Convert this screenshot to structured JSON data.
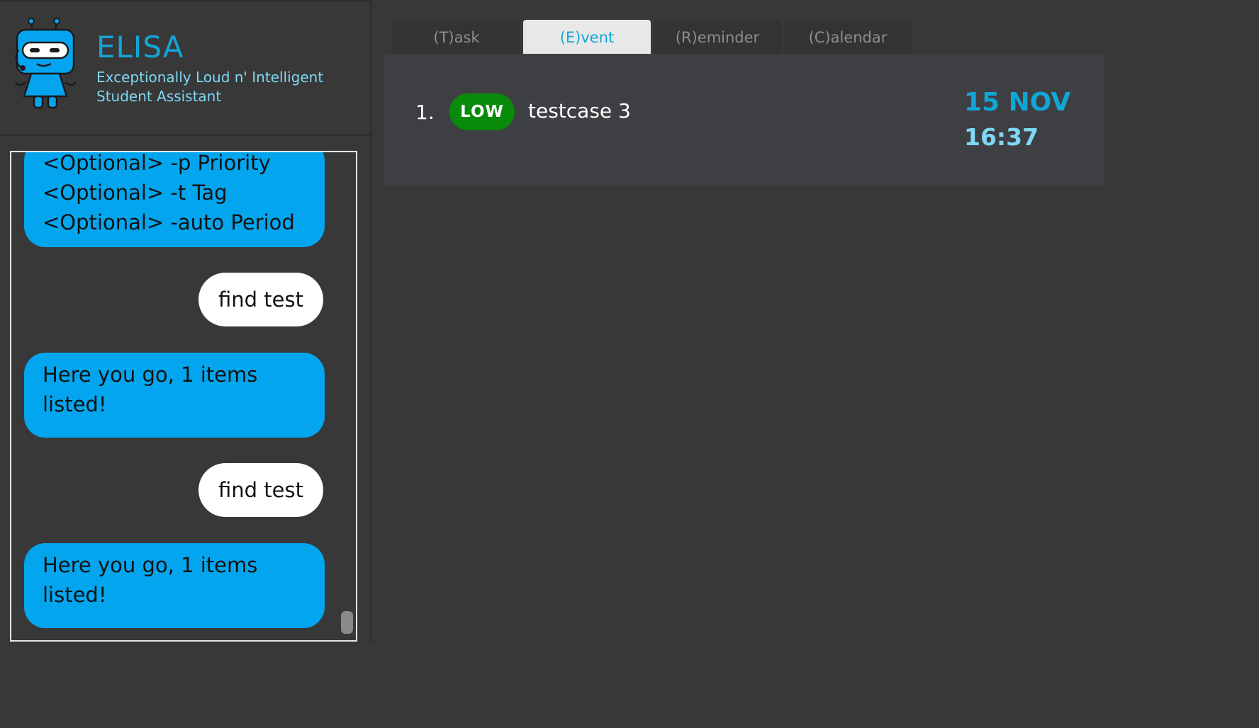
{
  "app": {
    "title": "ELISA",
    "subtitle": "Exceptionally Loud n' Intelligent Student Assistant",
    "logo_icon": "robot-icon"
  },
  "chat": {
    "messages": [
      {
        "sender": "bot",
        "text": "<Optional> -p Priority\n<Optional> -t Tag\n<Optional> -auto Period"
      },
      {
        "sender": "user",
        "text": "find test"
      },
      {
        "sender": "bot",
        "text": "Here you go, 1 items\nlisted!"
      },
      {
        "sender": "user",
        "text": "find test"
      },
      {
        "sender": "bot",
        "text": "Here you go, 1 items\nlisted!"
      }
    ]
  },
  "tabs": [
    {
      "label": "(T)ask",
      "active": false
    },
    {
      "label": "(E)vent",
      "active": true
    },
    {
      "label": "(R)eminder",
      "active": false
    },
    {
      "label": "(C)alendar",
      "active": false
    }
  ],
  "events": [
    {
      "index": "1.",
      "priority": "LOW",
      "description": "testcase 3",
      "date": "15 NOV",
      "time": "16:37"
    }
  ],
  "colors": {
    "accent": "#11a6d8",
    "bot_bubble": "#03a6ee",
    "user_bubble": "#ffffff",
    "priority_low": "#0a8a0a",
    "background": "#383838"
  }
}
